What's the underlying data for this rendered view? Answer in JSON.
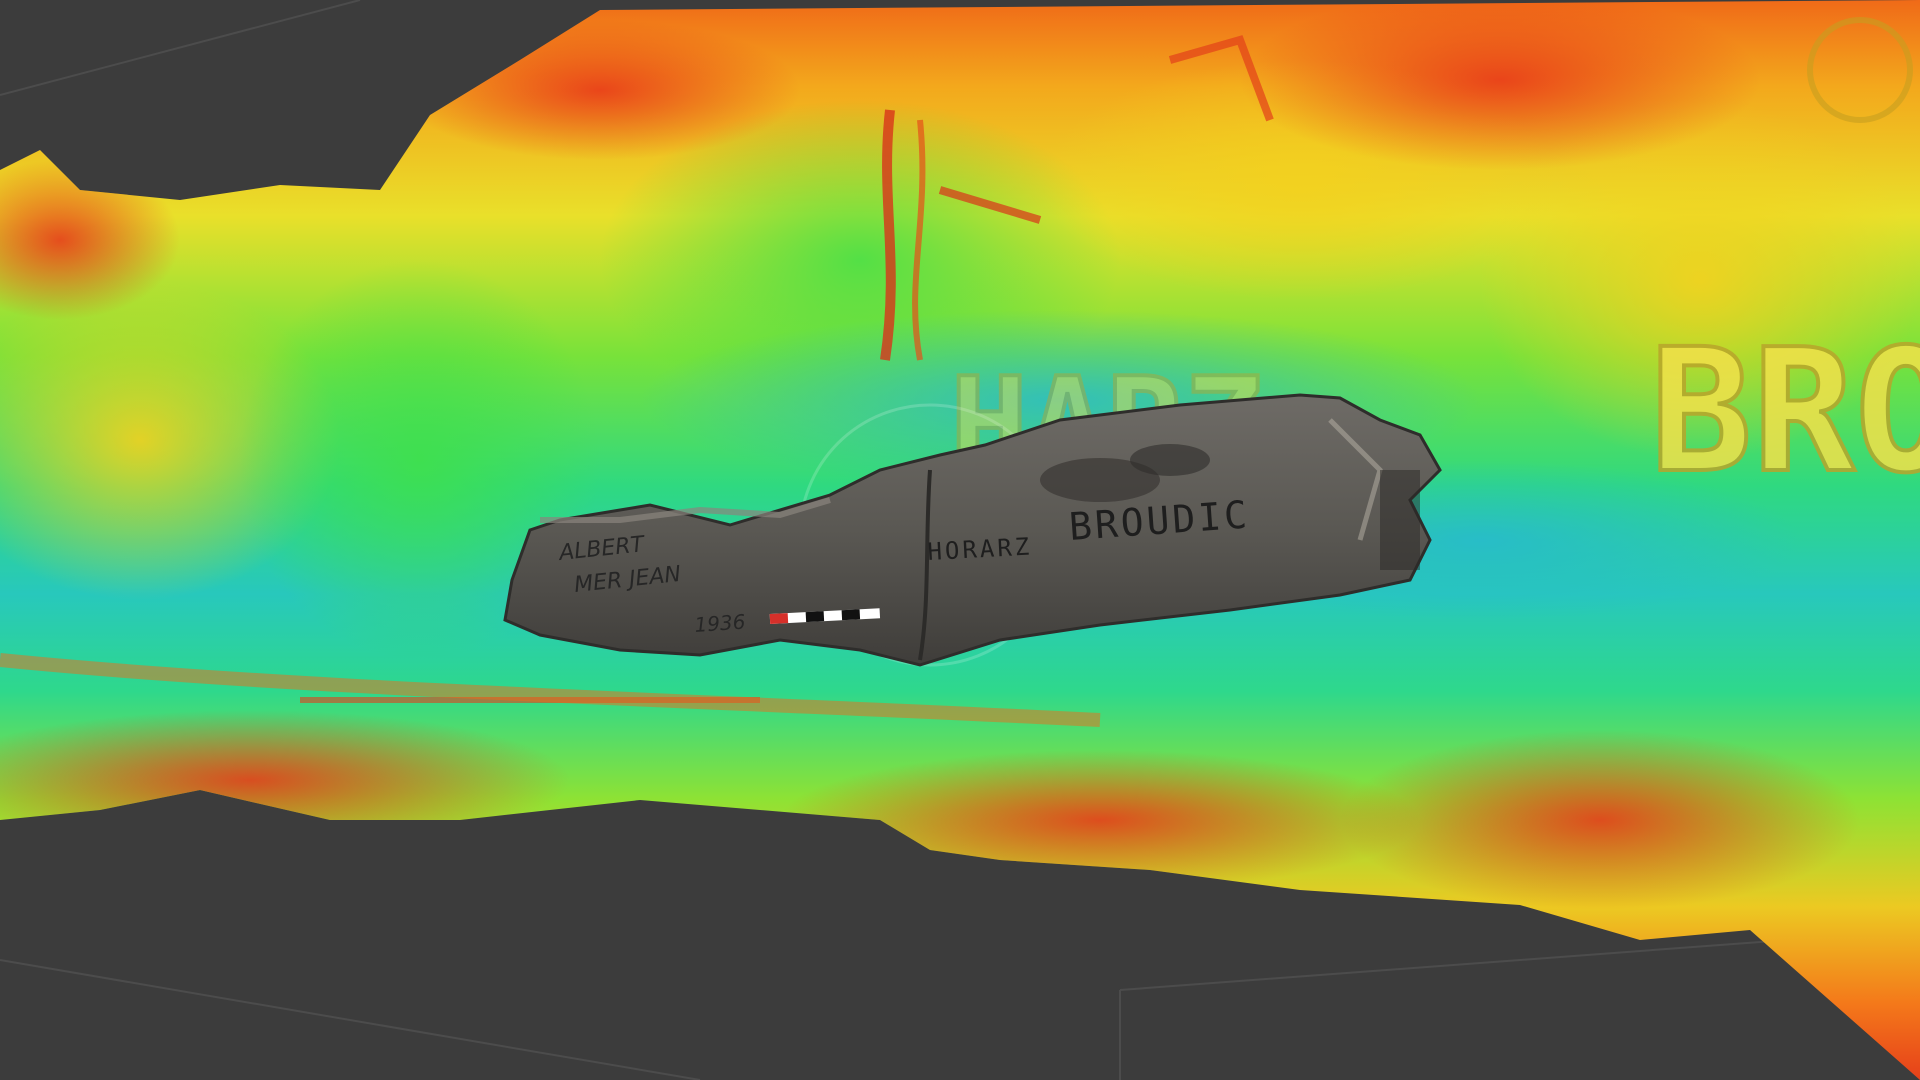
{
  "viewer": {
    "background": "#3c3c3c",
    "grid_color": "#4a4a4a"
  },
  "heatmap": {
    "colors": [
      "#e83a1a",
      "#f47a16",
      "#f3c81f",
      "#d9ea2a",
      "#66e23a",
      "#2ee06a",
      "#26d4a8",
      "#2ab6c8"
    ]
  },
  "fragment": {
    "color": "#5c5a56",
    "inscriptions": {
      "main": "BROUDIC",
      "prefix": "HORARZ",
      "left_line1": "ALBERT",
      "left_line2": "MER JEAN",
      "year": "1936"
    },
    "scale_bar_colors": [
      "#d6302a",
      "#ffffff",
      "#111111"
    ]
  },
  "relief_text": {
    "word1": "HARZ",
    "word2": "BRO"
  }
}
